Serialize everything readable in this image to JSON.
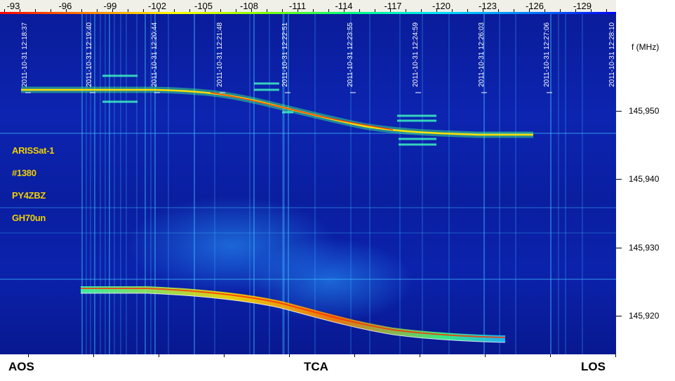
{
  "db_scale": {
    "labels": [
      "-93",
      "-96",
      "-99",
      "-102",
      "-105",
      "-108",
      "-111",
      "-114",
      "-117",
      "-120",
      "-123",
      "-126",
      "-129"
    ]
  },
  "freq_axis": {
    "unit": "f (MHz)",
    "labels": [
      "145,950",
      "145,940",
      "145,930",
      "145,920"
    ]
  },
  "info": {
    "satellite": "ARISSat-1",
    "number": "#1380",
    "callsign": "PY4ZBZ",
    "locator": "GH70un"
  },
  "timestamps": [
    "2011-10-31 12:18:37",
    "2011-10-31 12:19:40",
    "2011-10-31 12:20:44",
    "2011-10-31 12:21:48",
    "2011-10-31 12:22:51",
    "2011-10-31 12:23:55",
    "2011-10-31 12:24:59",
    "2011-10-31 12:26:03",
    "2011-10-31 12:27:06",
    "2011-10-31 12:28:10"
  ],
  "pass": {
    "aos": "AOS",
    "tca": "TCA",
    "los": "LOS"
  },
  "colors": {
    "waterfall_bg": "#0c24b0",
    "signal_core": "#ffe000",
    "signal_hot": "#ff3000",
    "signal_green": "#40ff60",
    "label_yellow": "#f0d000"
  }
}
